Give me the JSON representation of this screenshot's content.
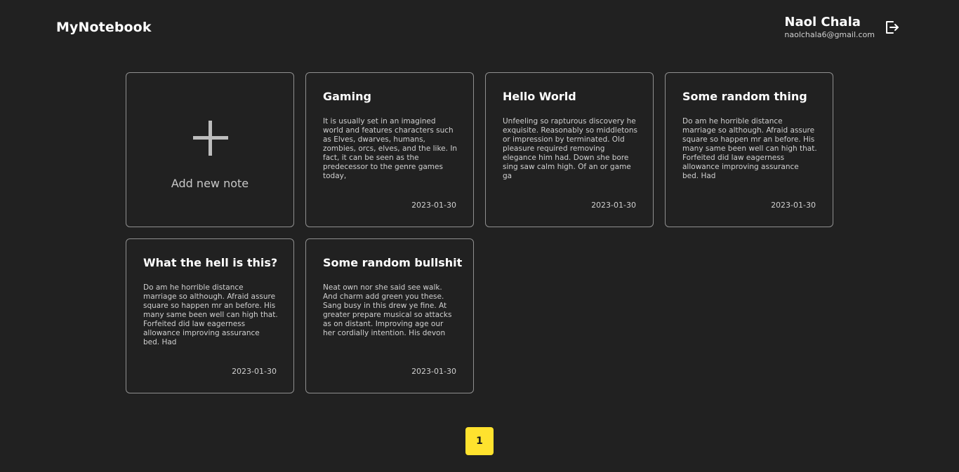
{
  "header": {
    "brand": "MyNotebook",
    "user_name": "Naol Chala",
    "user_email": "naolchala6@gmail.com",
    "logout_icon": "logout-icon"
  },
  "add_card": {
    "label": "Add new note",
    "icon": "plus-icon"
  },
  "notes": [
    {
      "title": "Gaming",
      "body": "It is usually set in an imagined world and features characters such as Elves, dwarves, humans, zombies, orcs, elves, and the like. In fact, it can be seen as the predecessor to the genre games today,",
      "date": "2023-01-30"
    },
    {
      "title": "Hello World",
      "body": "Unfeeling so rapturous discovery he exquisite. Reasonably so middletons or impression by terminated. Old pleasure required removing elegance him had. Down she bore sing saw calm high. Of an or game ga",
      "date": "2023-01-30"
    },
    {
      "title": "Some random thing",
      "body": "Do am he horrible distance marriage so although. Afraid assure square so happen mr an before. His many same been well can high that. Forfeited did law eagerness allowance improving assurance bed. Had",
      "date": "2023-01-30"
    },
    {
      "title": "What the hell is this?",
      "body": "Do am he horrible distance marriage so although. Afraid assure square so happen mr an before. His many same been well can high that. Forfeited did law eagerness allowance improving assurance bed. Had",
      "date": "2023-01-30"
    },
    {
      "title": "Some random bullshit",
      "body": "Neat own nor she said see walk. And charm add green you these. Sang busy in this drew ye fine. At greater prepare musical so attacks as on distant. Improving age our her cordially intention. His devon",
      "date": "2023-01-30"
    }
  ],
  "pagination": {
    "current_page": "1"
  },
  "colors": {
    "background": "#212121",
    "card_border": "#8f8f8f",
    "accent": "#ffe22e"
  }
}
